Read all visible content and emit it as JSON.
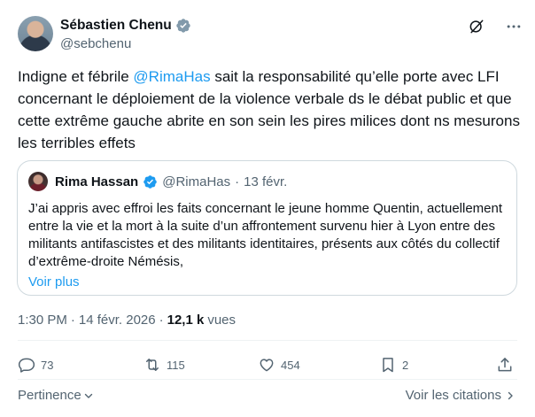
{
  "author": {
    "display_name": "Sébastien Chenu",
    "handle": "@sebchenu"
  },
  "header_icons": [
    "grok-icon",
    "more-icon"
  ],
  "tweet": {
    "text_before": "Indigne et fébrile ",
    "mention": "@RimaHas",
    "text_after": " sait la responsabilité qu’elle porte avec LFI concernant le déploiement de la violence verbale ds le débat public et que cette extrême gauche abrite en son sein les pires milices dont ns mesurons les terribles effets"
  },
  "quote": {
    "display_name": "Rima Hassan",
    "handle": "@RimaHas",
    "separator": "·",
    "date": "13 févr.",
    "text": "J’ai appris avec effroi les faits concernant le jeune homme Quentin, actuellement entre la vie et la mort à la suite d’un affrontement survenu hier à Lyon entre des militants antifascistes et des militants identitaires, présents aux côtés du collectif d’extrême-droite Némésis,",
    "more_label": "Voir plus"
  },
  "meta": {
    "time": "1:30 PM",
    "separator1": "·",
    "date": "14 févr. 2026",
    "separator2": "·",
    "views_count": "12,1 k",
    "views_label": "vues"
  },
  "actions": {
    "replies": "73",
    "reposts": "115",
    "likes": "454",
    "bookmarks": "2"
  },
  "footer": {
    "sort_label": "Pertinence",
    "citations_label": "Voir les citations"
  },
  "colors": {
    "accent": "#1d9bf0",
    "text": "#0f1419",
    "muted": "#536471",
    "border": "#cfd9de"
  }
}
